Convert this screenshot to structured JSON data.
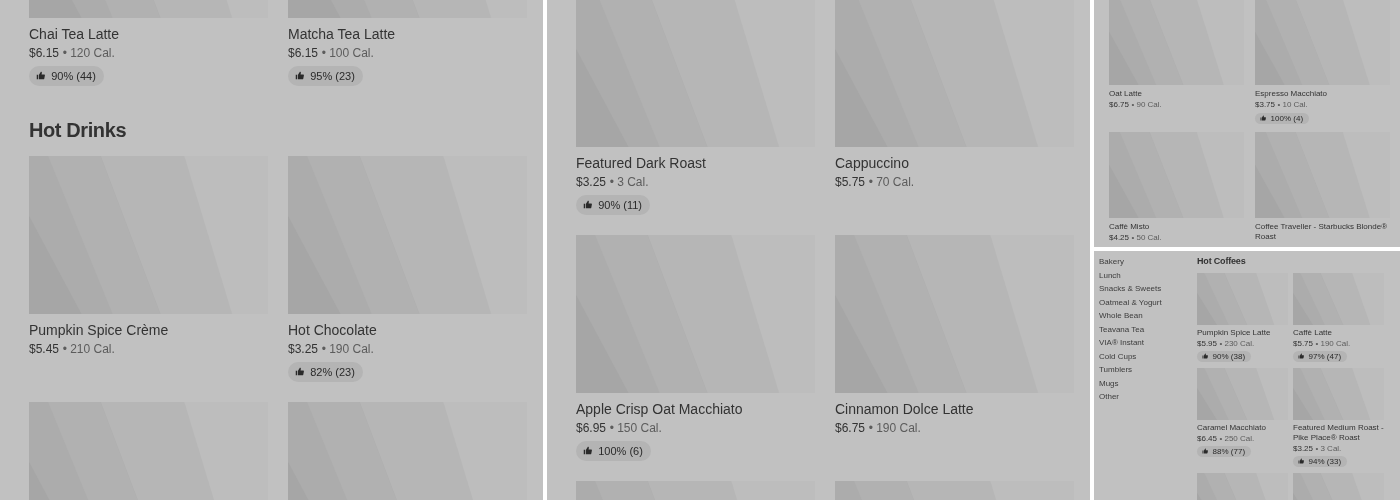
{
  "panels": [
    {
      "rows": [
        {
          "kind": "cards",
          "items": [
            {
              "kind": "dish",
              "name": "Chai Tea Latte",
              "price": "$6.15",
              "calories": "• 120 Cal.",
              "rating": "90% (44)"
            },
            {
              "kind": "dish",
              "name": "Matcha Tea Latte",
              "price": "$6.15",
              "calories": "• 100 Cal.",
              "rating": "95% (23)"
            }
          ]
        },
        {
          "kind": "heading",
          "text": "Hot Drinks"
        },
        {
          "kind": "cards",
          "items": [
            {
              "kind": "dish",
              "name": "Pumpkin Spice Crème",
              "price": "$5.45",
              "calories": "• 210 Cal."
            },
            {
              "kind": "dish",
              "name": "Hot Chocolate",
              "price": "$3.25",
              "calories": "• 190 Cal.",
              "rating": "82% (23)"
            }
          ]
        },
        {
          "kind": "cards"
        }
      ]
    },
    {
      "rows": [
        {
          "kind": "cards",
          "items": [
            {
              "kind": "dish",
              "name": "Featured Dark Roast",
              "price": "$3.25",
              "calories": "• 3 Cal.",
              "rating": "90% (11)"
            },
            {
              "kind": "dish",
              "name": "Cappuccino",
              "price": "$5.75",
              "calories": "• 70 Cal."
            }
          ]
        },
        {
          "kind": "cards",
          "items": [
            {
              "kind": "dish",
              "name": "Apple Crisp Oat Macchiato",
              "price": "$6.95",
              "calories": "• 150 Cal.",
              "rating": "100% (6)"
            },
            {
              "kind": "dish",
              "name": "Cinnamon Dolce Latte",
              "price": "$6.75",
              "calories": "• 190 Cal."
            }
          ]
        },
        {
          "kind": "cards"
        }
      ]
    },
    {
      "rows": [
        {
          "kind": "cards",
          "items": [
            {
              "kind": "dish",
              "name": "Oat Latte",
              "price": "$6.75",
              "calories": "• 90 Cal."
            },
            {
              "kind": "dish",
              "name": "Espresso Macchiato",
              "price": "$3.75",
              "calories": "• 10 Cal.",
              "rating": "100% (4)"
            }
          ]
        },
        {
          "kind": "cards",
          "items": [
            {
              "kind": "dish",
              "name": "Caffè Misto",
              "price": "$4.25",
              "calories": "• 50 Cal."
            },
            {
              "kind": "dish",
              "name": "Coffee Traveller - Starbucks Blonde® Roast"
            }
          ]
        }
      ]
    },
    {
      "sidebar": {
        "items": [
          "Bakery",
          "Lunch",
          "Snacks & Sweets",
          "Oatmeal & Yogurt",
          "Whole Bean",
          "Teavana Tea",
          "VIA® Instant",
          "Cold Cups",
          "Tumblers",
          "Mugs",
          "Other"
        ]
      },
      "rows": [
        {
          "kind": "heading",
          "text": "Hot Coffees"
        },
        {
          "kind": "cards",
          "items": [
            {
              "kind": "dish",
              "name": "Pumpkin Spice Latte",
              "price": "$5.95",
              "calories": "• 230 Cal.",
              "rating": "90% (38)"
            },
            {
              "kind": "dish",
              "name": "Caffè Latte",
              "price": "$5.75",
              "calories": "• 190 Cal.",
              "rating": "97% (47)"
            }
          ]
        },
        {
          "kind": "cards",
          "items": [
            {
              "kind": "dish",
              "name": "Caramel Macchiato",
              "price": "$6.45",
              "calories": "• 250 Cal.",
              "rating": "88% (77)"
            },
            {
              "kind": "dish",
              "name": "Featured Medium Roast - Pike Place® Roast",
              "price": "$3.25",
              "calories": "• 3 Cal.",
              "rating": "94% (33)"
            }
          ]
        },
        {
          "kind": "cards"
        }
      ]
    }
  ]
}
